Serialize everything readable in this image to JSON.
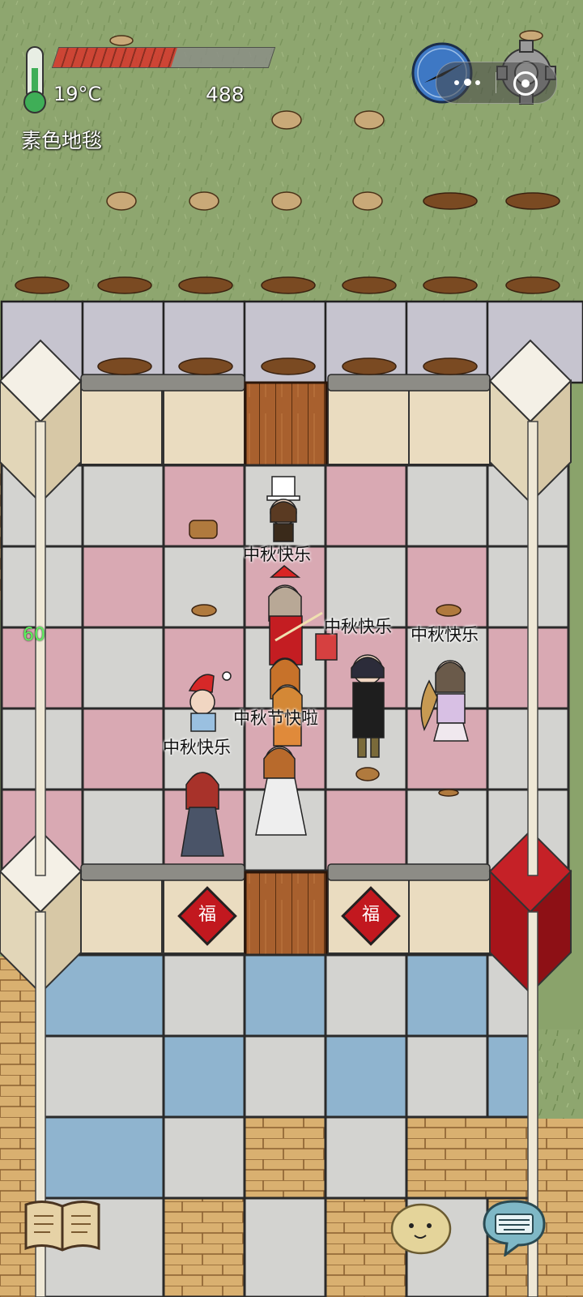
{
  "hud": {
    "temperature": "19°C",
    "health_fraction": 0.55,
    "score": "488",
    "location": "素色地毯",
    "fps": "60"
  },
  "chat_bubbles": [
    {
      "id": "b1",
      "text": "中秋快乐"
    },
    {
      "id": "b2",
      "text": "中秋快乐"
    },
    {
      "id": "b3",
      "text": "中秋快乐"
    },
    {
      "id": "b4",
      "text": "中秋节快啦"
    },
    {
      "id": "b5",
      "text": "中秋快乐"
    }
  ],
  "decor": {
    "fu_glyph": "福"
  },
  "icons": {
    "thermometer": "thermometer-icon",
    "compass": "compass-icon",
    "settings": "gear-icon",
    "menu": "more-dots-icon",
    "close": "target-icon",
    "book": "book-icon",
    "emote": "potato-face-icon",
    "keyboard": "keyboard-icon"
  },
  "colors": {
    "grass": "#8ea66f",
    "pink_tile": "#d9a9b3",
    "grey_tile": "#d3d3d0",
    "blue_tile": "#8fb4cf",
    "wood": "#a8602e",
    "health": "#d9352b",
    "red_block": "#b5161c"
  }
}
